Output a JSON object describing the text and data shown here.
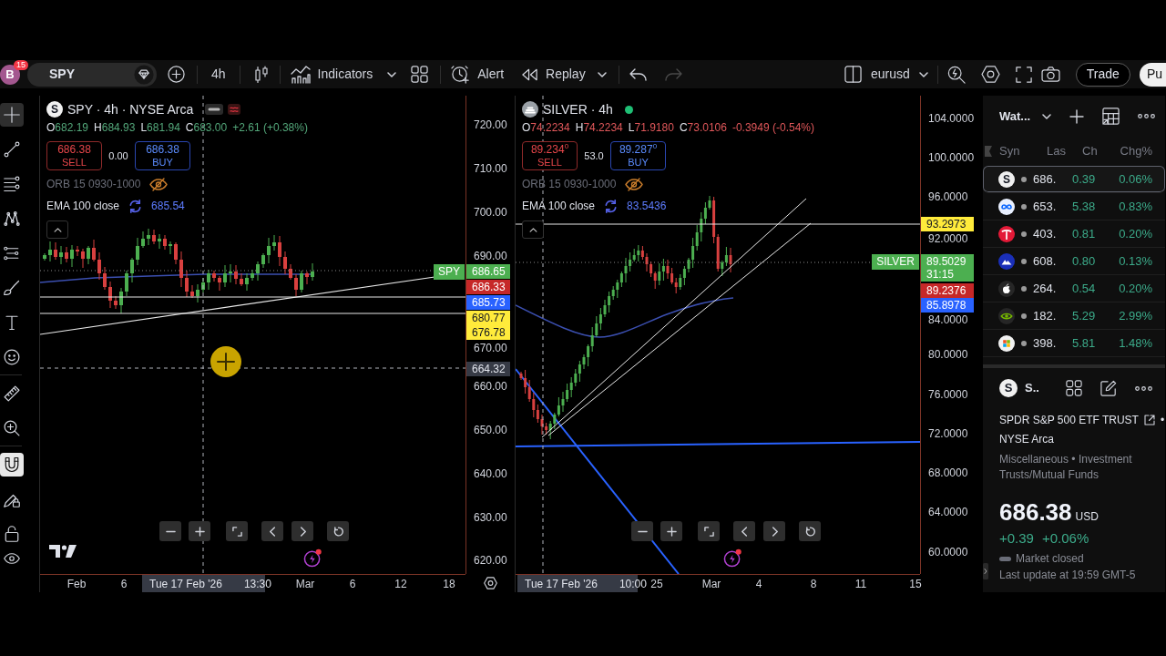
{
  "toolbar": {
    "avatar": {
      "initial": "B",
      "badge": "15"
    },
    "symbol": "SPY",
    "interval": "4h",
    "indicators": "Indicators",
    "alert": "Alert",
    "replay": "Replay",
    "history": [
      {
        "kind": "undo",
        "disabled": false
      },
      {
        "kind": "redo",
        "disabled": true
      }
    ],
    "layout": "eurusd",
    "trade": "Trade",
    "publish": "Pu"
  },
  "tools": [
    {
      "kind": "crosshair",
      "selected": true
    },
    {
      "kind": "trend-line",
      "selected": false
    },
    {
      "kind": "fib",
      "selected": false
    },
    {
      "kind": "pattern",
      "selected": false
    },
    {
      "kind": "forecast",
      "selected": false
    },
    {
      "kind": "brush",
      "selected": false
    },
    {
      "kind": "text",
      "selected": false
    },
    {
      "kind": "emoji",
      "selected": false
    },
    {
      "kind": "ruler",
      "selected": false
    },
    {
      "kind": "zoom",
      "selected": false
    },
    {
      "kind": "magnet",
      "selected": true
    },
    {
      "kind": "lock-drawing",
      "selected": false
    },
    {
      "kind": "lock",
      "selected": false
    },
    {
      "kind": "eye",
      "selected": false
    }
  ],
  "charts": [
    {
      "title": "SPY · 4h · NYSE Arca",
      "logo": {
        "kind": "letter",
        "text": "S"
      },
      "market_open": false,
      "ohlc": [
        {
          "label": "O",
          "value": "682.19"
        },
        {
          "label": "H",
          "value": "684.93"
        },
        {
          "label": "L",
          "value": "681.94"
        },
        {
          "label": "C",
          "value": "683.00"
        }
      ],
      "change": "+2.61 (+0.38%)",
      "rising": true,
      "sell": {
        "price": "686.38",
        "label": "SELL"
      },
      "spread": "0.00",
      "buy": {
        "price": "686.38",
        "label": "BUY"
      },
      "indicators": [
        {
          "name": "ORB 15 0930-1000",
          "hidden": true
        },
        {
          "name": "EMA 100 close",
          "hidden": false,
          "value": "685.54"
        }
      ],
      "price_axis": [
        "720.00",
        "710.00",
        "700.00",
        "690.00",
        "670.00",
        "660.00",
        "650.00",
        "640.00",
        "630.00",
        "620.00"
      ],
      "symbol_tag": {
        "label": "SPY",
        "price": "686.65",
        "color": "#4caf50"
      },
      "price_tags": [
        {
          "price": "686.33",
          "color": "#c62828"
        },
        {
          "price": "685.73",
          "color": "#2962ff"
        },
        {
          "price": "680.77",
          "color": "#ffeb3b"
        },
        {
          "price": "676.78",
          "color": "#ffeb3b"
        }
      ],
      "crosshair_price": "664.32",
      "time_axis": [
        "Feb",
        "6",
        "Mar",
        "6",
        "12",
        "18"
      ],
      "crosshair_time": {
        "date": "Tue 17 Feb '26",
        "time": "13:30"
      }
    },
    {
      "title": "SILVER · 4h",
      "logo": {
        "kind": "bars"
      },
      "market_open": true,
      "ohlc": [
        {
          "label": "O",
          "value": "74.2234"
        },
        {
          "label": "H",
          "value": "74.2234"
        },
        {
          "label": "L",
          "value": "71.9180"
        },
        {
          "label": "C",
          "value": "73.0106"
        }
      ],
      "change": "-0.3949 (-0.54%)",
      "rising": false,
      "sell": {
        "price": "89.234$^{0}$",
        "label": "SELL"
      },
      "spread": "53.0",
      "buy": {
        "price": "89.287$^{0}$",
        "label": "BUY"
      },
      "indicators": [
        {
          "name": "ORB 15 0930-1000",
          "hidden": true
        },
        {
          "name": "EMA 100 close",
          "hidden": false,
          "value": "83.5436"
        }
      ],
      "price_axis": [
        "104.0000",
        "100.0000",
        "96.0000",
        "92.0000",
        "84.0000",
        "80.0000",
        "76.0000",
        "72.0000",
        "68.0000",
        "64.0000",
        "60.0000"
      ],
      "symbol_tag": {
        "label": "SILVER",
        "price": "89.5029",
        "countdown": "31:15",
        "color": "#4caf50"
      },
      "price_tags": [
        {
          "price": "93.2973",
          "color": "#ffeb3b"
        },
        {
          "price": "89.2376",
          "color": "#c62828"
        },
        {
          "price": "85.8978",
          "color": "#2962ff"
        }
      ],
      "time_axis": [
        "25",
        "Mar",
        "4",
        "8",
        "11",
        "15"
      ],
      "crosshair_time": {
        "date": "Tue 17 Feb '26",
        "time": "10:00"
      }
    }
  ],
  "watchlist": {
    "title": "Wat...",
    "columns": [
      "Syn",
      "Las",
      "Ch",
      "Chg%"
    ],
    "rows": [
      {
        "icon": {
          "kind": "letter",
          "text": "S",
          "color": "#f0f0f0"
        },
        "last": "686.",
        "change": "0.39",
        "change_pct": "0.06%",
        "selected": true
      },
      {
        "icon": {
          "kind": "infinity",
          "color": "#e8f0ff"
        },
        "last": "653.",
        "change": "5.38",
        "change_pct": "0.83%",
        "selected": false
      },
      {
        "icon": {
          "kind": "t-mark",
          "color": "#e31937"
        },
        "last": "403.",
        "change": "0.81",
        "change_pct": "0.20%",
        "selected": false
      },
      {
        "icon": {
          "kind": "mountain",
          "color": "#1a2fb8"
        },
        "last": "608.",
        "change": "0.80",
        "change_pct": "0.13%",
        "selected": false
      },
      {
        "icon": {
          "kind": "apple",
          "color": "#262626"
        },
        "last": "264.",
        "change": "0.54",
        "change_pct": "0.20%",
        "selected": false
      },
      {
        "icon": {
          "kind": "eye",
          "color": "#262626"
        },
        "last": "182.",
        "change": "5.29",
        "change_pct": "2.99%",
        "selected": false
      },
      {
        "icon": {
          "kind": "squares",
          "color": "#f2f2f2"
        },
        "last": "398.",
        "change": "5.81",
        "change_pct": "1.48%",
        "selected": false
      }
    ]
  },
  "details": {
    "logo": "S",
    "symbol": "S..",
    "name": "SPDR S&P 500 ETF TRUST",
    "name_suffix": "•",
    "exchange": "NYSE Arca",
    "category": "Miscellaneous • Investment Trusts/Mutual Funds",
    "price": "686.38",
    "currency": "USD",
    "change": "+0.39",
    "change_pct": "+0.06%",
    "market_status": "Market closed",
    "updated": "Last update at 19:59 GMT-5"
  }
}
